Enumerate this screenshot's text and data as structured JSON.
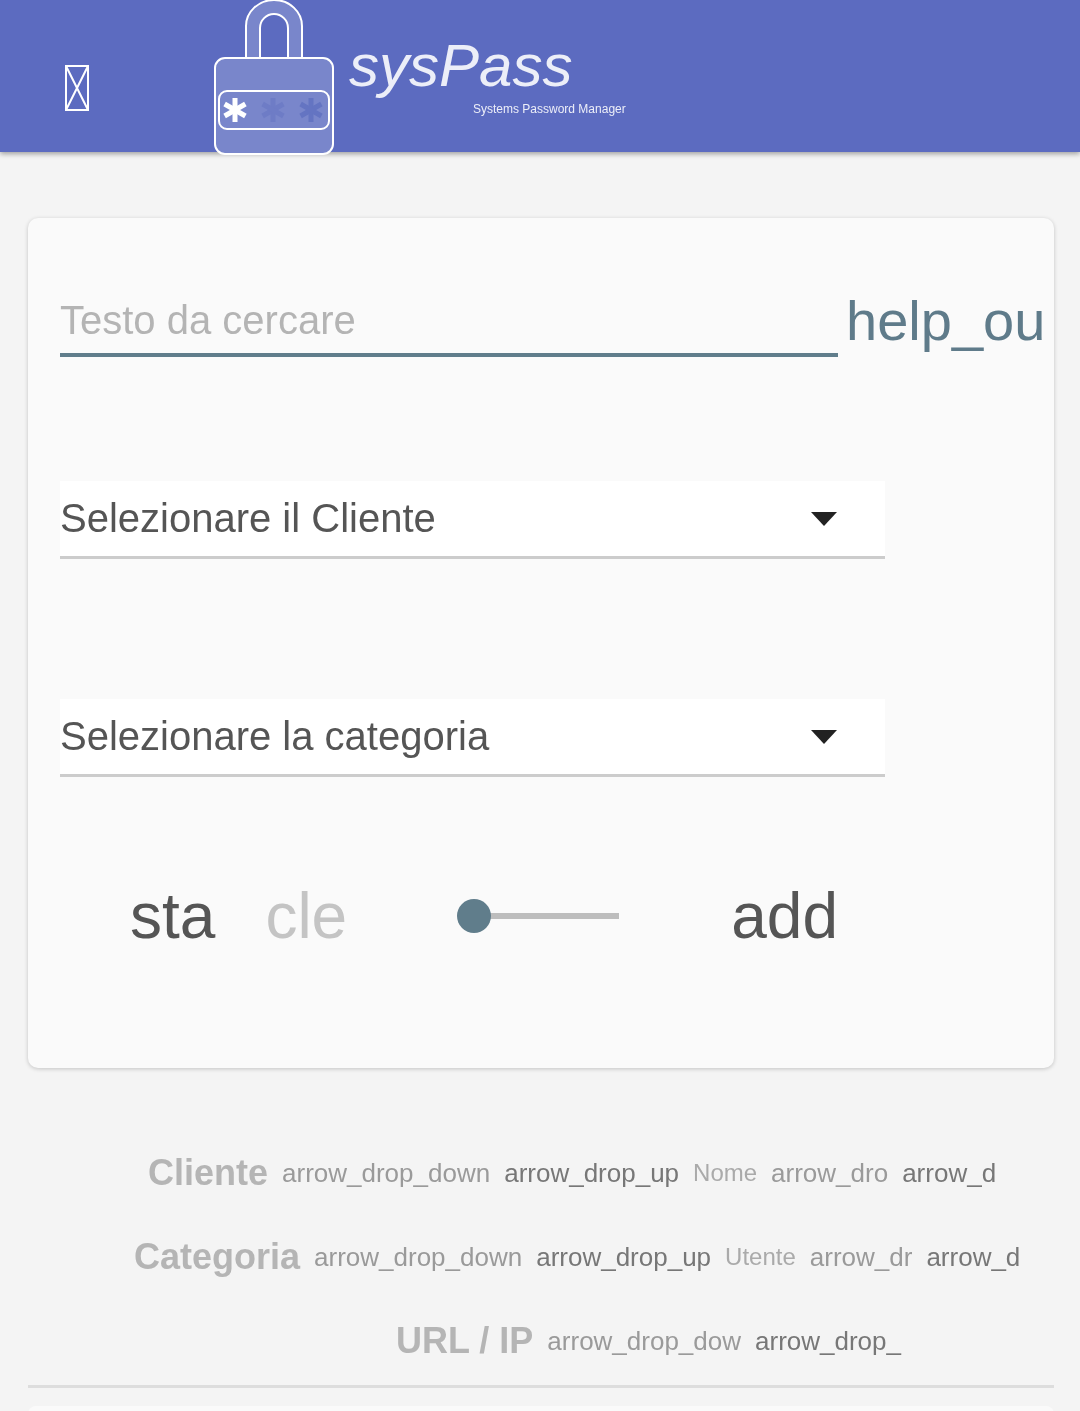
{
  "header": {
    "title": "sysPass",
    "subtitle": "Systems Password Manager"
  },
  "search": {
    "placeholder": "Testo da cercare",
    "help": "help_ou"
  },
  "selects": [
    {
      "placeholder": "Selezionare il Cliente"
    },
    {
      "placeholder": "Selezionare la categoria"
    }
  ],
  "actions": {
    "star": "sta",
    "clear": "cle",
    "toggle": {
      "on": false
    },
    "add": "add"
  },
  "sort_rows": [
    {
      "label": "Cliente",
      "layers": [
        {
          "kind": "light",
          "text": "arrow_drop_down"
        },
        {
          "kind": "dark",
          "text": "arrow_drop_up"
        },
        {
          "kind": "mid",
          "text": "Nome"
        },
        {
          "kind": "light",
          "text": "arrow_dro"
        },
        {
          "kind": "dark",
          "text": "arrow_d"
        }
      ]
    },
    {
      "label": "Categoria",
      "layers": [
        {
          "kind": "light",
          "text": "arrow_drop_down"
        },
        {
          "kind": "dark",
          "text": "arrow_drop_up"
        },
        {
          "kind": "mid",
          "text": "Utente"
        },
        {
          "kind": "light",
          "text": "arrow_dr"
        },
        {
          "kind": "dark",
          "text": "arrow_d"
        }
      ]
    },
    {
      "label": "URL / IP",
      "layers": [
        {
          "kind": "light",
          "text": "arrow_drop_dow"
        },
        {
          "kind": "dark",
          "text": "arrow_drop_"
        }
      ]
    }
  ]
}
